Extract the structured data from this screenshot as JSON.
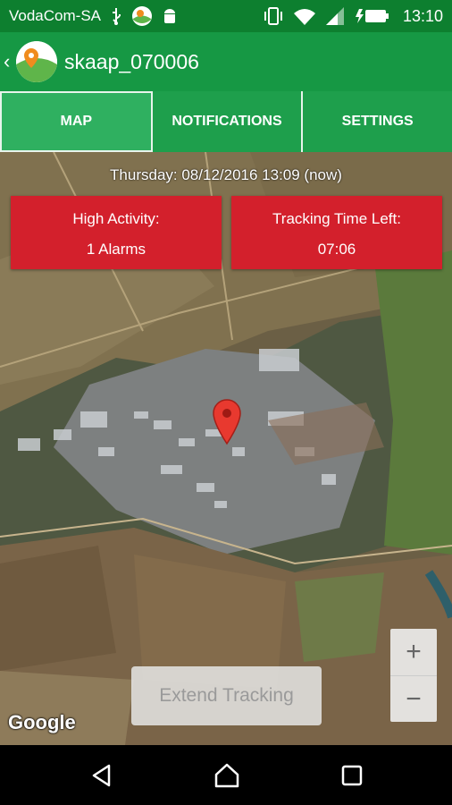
{
  "status_bar": {
    "carrier": "VodaCom-SA",
    "time": "13:10",
    "left_icons": [
      "usb-icon",
      "app-notification-icon",
      "android-debug-icon"
    ],
    "right_icons": [
      "vibrate-icon",
      "wifi-icon",
      "signal-icon",
      "battery-charging-icon"
    ]
  },
  "app_bar": {
    "title": "skaap_070006",
    "background": "#169844"
  },
  "tabs": [
    {
      "label": "MAP",
      "active": true
    },
    {
      "label": "NOTIFICATIONS",
      "active": false
    },
    {
      "label": "SETTINGS",
      "active": false
    }
  ],
  "map": {
    "timestamp": "Thursday: 08/12/2016 13:09 (now)",
    "activity_card": {
      "title": "High Activity:",
      "value": "1 Alarms"
    },
    "tracking_card": {
      "title": "Tracking Time Left:",
      "value": "07:06"
    },
    "card_color": "#d3202c",
    "marker_icon": "location-pin-icon",
    "extend_button": "Extend Tracking",
    "zoom_in": "+",
    "zoom_out": "−",
    "attribution": "Google"
  },
  "nav_bar": {
    "buttons": [
      "back-icon",
      "home-icon",
      "recents-icon"
    ]
  }
}
